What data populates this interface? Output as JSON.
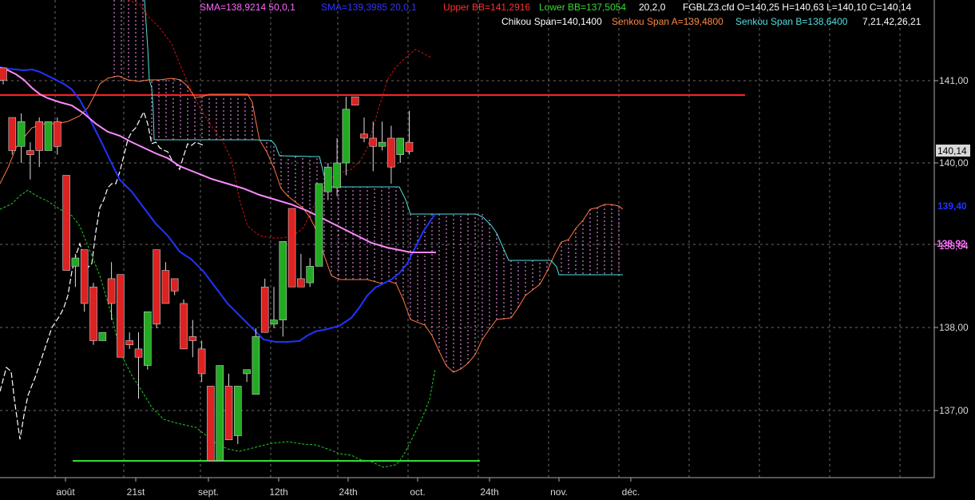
{
  "header": {
    "row1": [
      {
        "text": "SMA=138,9214  50,0,1",
        "color": "#ff66ff"
      },
      {
        "text": "SMA=139,3985  20,0,1",
        "color": "#3333ff"
      },
      {
        "text": "Upper BB=141,2916",
        "color": "#ff3030"
      },
      {
        "text": "Lower BB=137,5054",
        "color": "#33dd33"
      },
      {
        "text": "20,2,0",
        "color": "#ffffff"
      },
      {
        "text": "FGBLZ3.cfd O=140,25 H=140,63 L=140,10 C=140,14",
        "color": "#ffffff"
      }
    ],
    "row2": [
      {
        "text": "Chikou Span=140,1400",
        "color": "#ffffff"
      },
      {
        "text": "Senkou Span A=139,4800",
        "color": "#ff8844"
      },
      {
        "text": "Senkou Span B=138,6400",
        "color": "#55dddd"
      },
      {
        "text": "7,21,42,26,21",
        "color": "#ffffff"
      }
    ]
  },
  "x_axis_labels": [
    "août",
    "21st",
    "sept.",
    "12th",
    "24th",
    "oct.",
    "24th",
    "nov.",
    "déc."
  ],
  "y_axis_labels": [
    "141,00",
    "140,00",
    "138,00",
    "137,00"
  ],
  "price_tags": {
    "last_close": "140,14",
    "sma20": "139,40",
    "sma50": "138,92",
    "senkou_b": "138,64"
  },
  "colors": {
    "background": "#000000",
    "grid": "#6a6a6a",
    "candle_up": "#22aa22",
    "candle_down": "#dd2222",
    "sma50": "#ff88ff",
    "sma20": "#2233ff",
    "upper_bb": "#cc1111",
    "lower_bb": "#22cc22",
    "chikou": "#ffffff",
    "senkou_a": "#ff7744",
    "senkou_b": "#55dddd",
    "kumo_fill": "#ff99ff",
    "hline_resistance": "#ff2222",
    "hline_support": "#33dd33"
  },
  "chart_data": {
    "type": "candlestick",
    "title": "FGBLZ3.cfd",
    "instrument": "FGBLZ3.cfd",
    "y_range": [
      136.1,
      142.0
    ],
    "grid": true,
    "indicators": [
      "SMA 50",
      "SMA 20",
      "Bollinger Bands 20,2,0",
      "Ichimoku 7,21,42,26,21"
    ],
    "candles": [
      [
        141.15,
        141.1,
        140.95,
        141.0
      ],
      [
        140.55,
        140.55,
        140.1,
        140.15
      ],
      [
        140.2,
        140.6,
        140.0,
        140.5
      ],
      [
        140.15,
        140.25,
        139.8,
        140.1
      ],
      [
        140.5,
        140.55,
        139.95,
        140.15
      ],
      [
        140.15,
        140.5,
        140.15,
        140.5
      ],
      [
        140.5,
        140.55,
        140.1,
        140.2
      ],
      [
        139.85,
        139.85,
        138.7,
        138.7
      ],
      [
        138.75,
        138.9,
        138.5,
        138.85
      ],
      [
        138.95,
        138.95,
        138.2,
        138.3
      ],
      [
        138.5,
        138.55,
        137.8,
        137.85
      ],
      [
        137.85,
        137.95,
        137.85,
        137.95
      ],
      [
        138.6,
        138.8,
        138.1,
        138.3
      ],
      [
        138.65,
        138.65,
        137.65,
        137.65
      ],
      [
        137.85,
        137.95,
        137.75,
        137.8
      ],
      [
        137.75,
        137.95,
        137.15,
        137.65
      ],
      [
        137.55,
        138.2,
        137.5,
        138.2
      ],
      [
        138.95,
        138.95,
        138.0,
        138.05
      ],
      [
        138.7,
        138.8,
        138.3,
        138.3
      ],
      [
        138.6,
        138.6,
        138.4,
        138.45
      ],
      [
        138.3,
        138.35,
        137.75,
        137.75
      ],
      [
        137.9,
        138.1,
        137.65,
        137.85
      ],
      [
        137.75,
        137.85,
        137.35,
        137.45
      ],
      [
        137.3,
        137.3,
        136.4,
        136.4
      ],
      [
        136.4,
        137.55,
        136.4,
        137.55
      ],
      [
        137.3,
        137.45,
        136.65,
        136.65
      ],
      [
        136.7,
        137.3,
        136.6,
        137.3
      ],
      [
        137.45,
        137.5,
        137.35,
        137.5
      ],
      [
        137.2,
        138.0,
        137.2,
        137.9
      ],
      [
        138.5,
        138.6,
        137.95,
        137.95
      ],
      [
        138.05,
        138.5,
        138.0,
        138.1
      ],
      [
        138.1,
        139.05,
        137.9,
        139.05
      ],
      [
        139.45,
        139.45,
        138.5,
        138.5
      ],
      [
        138.6,
        138.9,
        138.5,
        138.5
      ],
      [
        138.55,
        138.85,
        138.5,
        138.75
      ],
      [
        138.75,
        139.75,
        138.75,
        139.75
      ],
      [
        139.65,
        140.0,
        139.55,
        139.95
      ],
      [
        139.7,
        140.3,
        139.6,
        140.0
      ],
      [
        140.0,
        140.8,
        139.85,
        140.65
      ],
      [
        140.8,
        140.8,
        140.7,
        140.7
      ],
      [
        140.35,
        140.55,
        140.25,
        140.3
      ],
      [
        140.3,
        140.5,
        139.9,
        140.2
      ],
      [
        140.2,
        140.5,
        140.15,
        140.25
      ],
      [
        140.3,
        140.45,
        139.75,
        139.95
      ],
      [
        140.1,
        140.3,
        140.0,
        140.3
      ],
      [
        140.25,
        140.63,
        140.1,
        140.14
      ]
    ]
  }
}
